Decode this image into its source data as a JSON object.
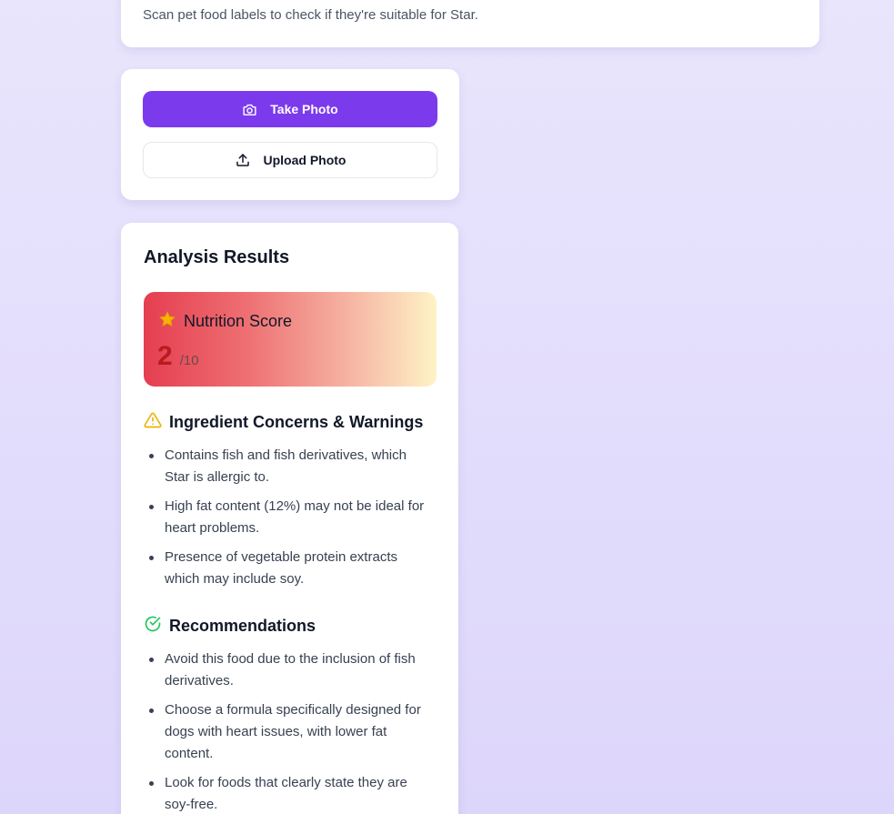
{
  "header": {
    "subtitle": "Scan pet food labels to check if they're suitable for Star."
  },
  "actions": {
    "take_photo_label": "Take Photo",
    "upload_photo_label": "Upload Photo"
  },
  "results": {
    "title": "Analysis Results",
    "score": {
      "label": "Nutrition Score",
      "value": "2",
      "max": "/10",
      "icon": "star-icon"
    },
    "concerns": {
      "title": "Ingredient Concerns & Warnings",
      "icon": "warning-triangle-icon",
      "items": [
        "Contains fish and fish derivatives, which Star is allergic to.",
        "High fat content (12%) may not be ideal for heart problems.",
        "Presence of vegetable protein extracts which may include soy."
      ]
    },
    "recommendations": {
      "title": "Recommendations",
      "icon": "check-circle-icon",
      "items": [
        "Avoid this food due to the inclusion of fish derivatives.",
        "Choose a formula specifically designed for dogs with heart issues, with lower fat content.",
        "Look for foods that clearly state they are soy-free."
      ]
    }
  },
  "colors": {
    "primary": "#7c3aed",
    "score_red": "#b91c1c",
    "warning": "#eab308",
    "success": "#22c55e"
  }
}
